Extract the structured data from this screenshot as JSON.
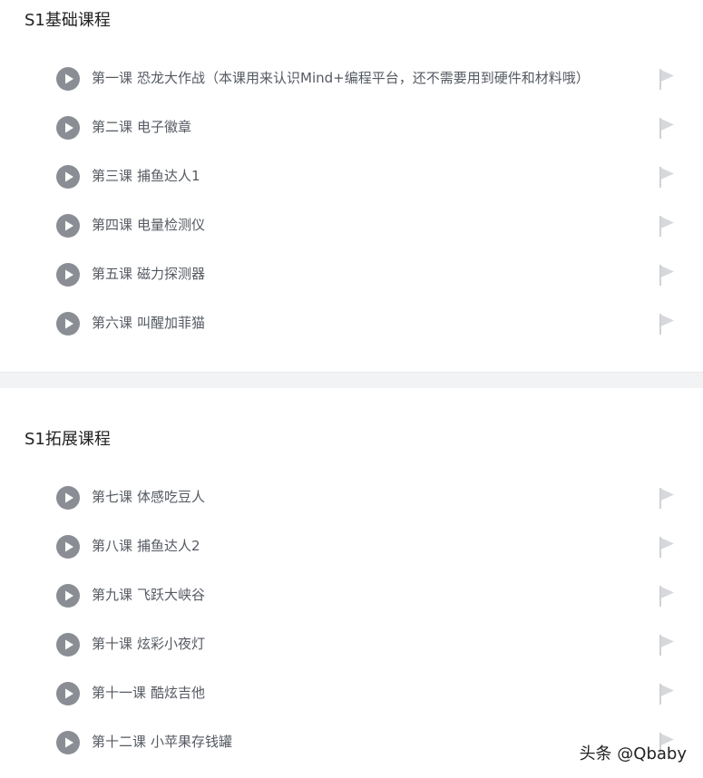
{
  "colors": {
    "play_icon_bg": "#8a8e94",
    "lesson_text": "#555a62",
    "title_text": "#222222",
    "flag": "#c4c7cc",
    "divider": "#f2f3f5"
  },
  "sections": [
    {
      "title": "S1基础课程",
      "lessons": [
        {
          "number": "第一课",
          "name": "恐龙大作战（本课用来认识Mind+编程平台，还不需要用到硬件和材料哦）"
        },
        {
          "number": "第二课",
          "name": "电子徽章"
        },
        {
          "number": "第三课",
          "name": "捕鱼达人1"
        },
        {
          "number": "第四课",
          "name": "电量检测仪"
        },
        {
          "number": "第五课",
          "name": "磁力探测器"
        },
        {
          "number": "第六课",
          "name": "叫醒加菲猫"
        }
      ]
    },
    {
      "title": "S1拓展课程",
      "lessons": [
        {
          "number": "第七课",
          "name": "体感吃豆人"
        },
        {
          "number": "第八课",
          "name": "捕鱼达人2"
        },
        {
          "number": "第九课",
          "name": "飞跃大峡谷"
        },
        {
          "number": "第十课",
          "name": "炫彩小夜灯"
        },
        {
          "number": "第十一课",
          "name": "酷炫吉他"
        },
        {
          "number": "第十二课",
          "name": "小苹果存钱罐"
        }
      ]
    }
  ],
  "watermark": "头条 @Qbaby",
  "icons": {
    "play": "play-circle-icon",
    "flag": "flag-icon"
  }
}
